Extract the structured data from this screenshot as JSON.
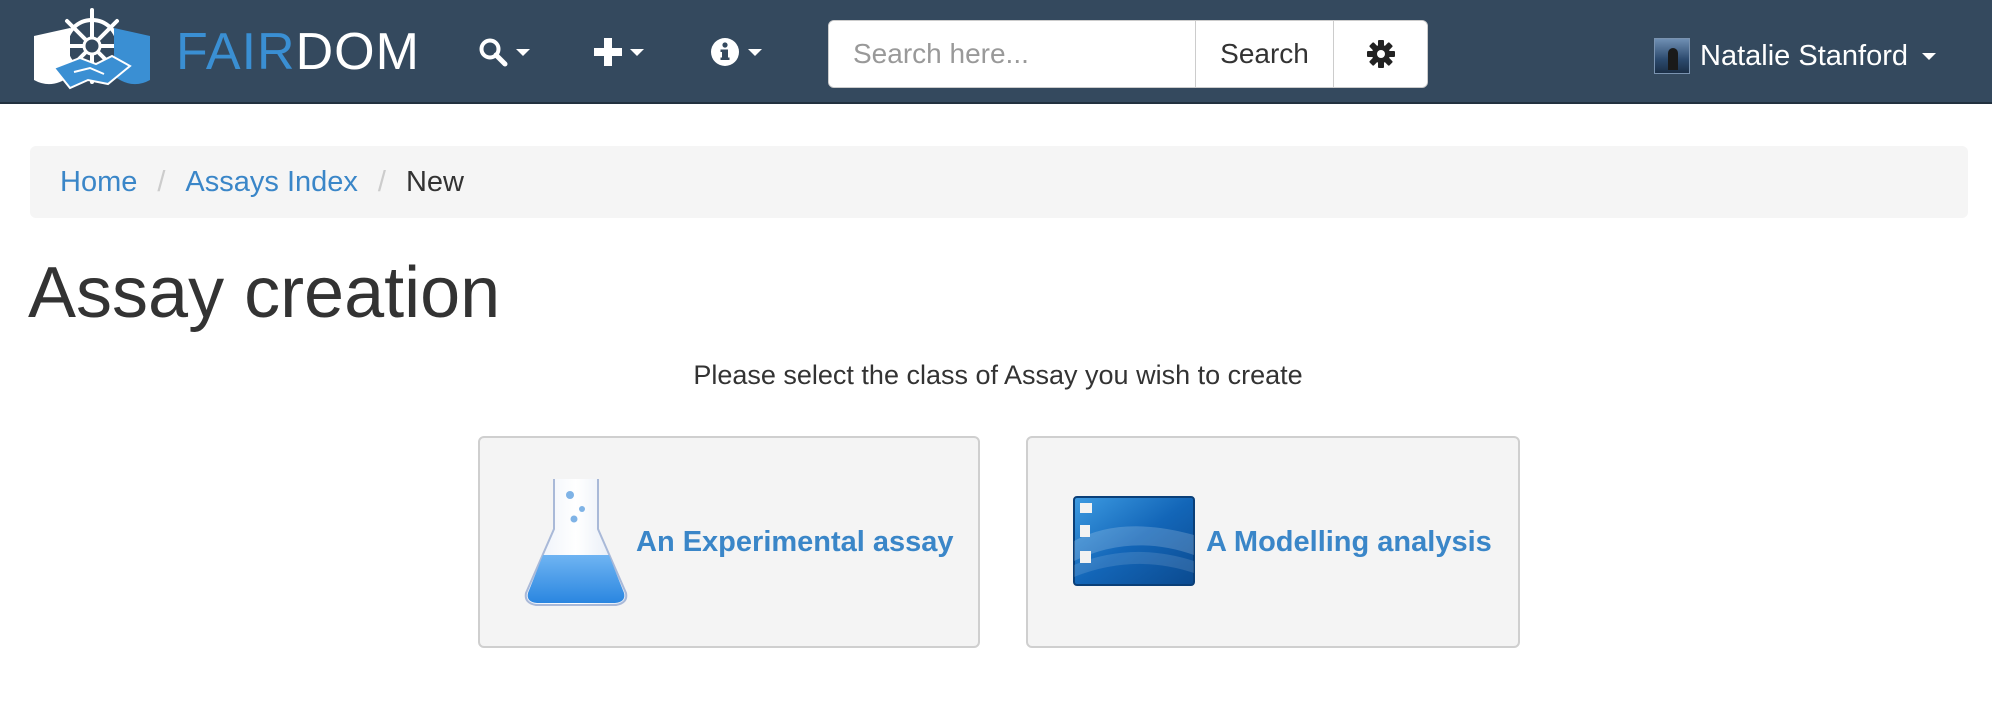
{
  "header": {
    "brand": {
      "part1": "FAIR",
      "part2": "DOM"
    },
    "search": {
      "placeholder": "Search here...",
      "button_label": "Search"
    },
    "user": {
      "name": "Natalie Stanford"
    },
    "icons": [
      "search-icon",
      "plus-icon",
      "info-icon",
      "gear-icon",
      "chevron-down-icon"
    ]
  },
  "breadcrumb": {
    "items": [
      {
        "label": "Home"
      },
      {
        "label": "Assays Index"
      },
      {
        "label": "New"
      }
    ],
    "separator": "/"
  },
  "main": {
    "title": "Assay creation",
    "instruction": "Please select the class of Assay you wish to create",
    "options": [
      {
        "label": "An Experimental assay",
        "icon": "flask-icon"
      },
      {
        "label": "A Modelling analysis",
        "icon": "desktop-window-icon"
      }
    ]
  },
  "colors": {
    "navbar_bg": "#34495e",
    "brand_accent": "#3a8fd3",
    "link": "#3a86c8",
    "card_bg": "#f4f4f4",
    "breadcrumb_bg": "#f5f5f5"
  }
}
